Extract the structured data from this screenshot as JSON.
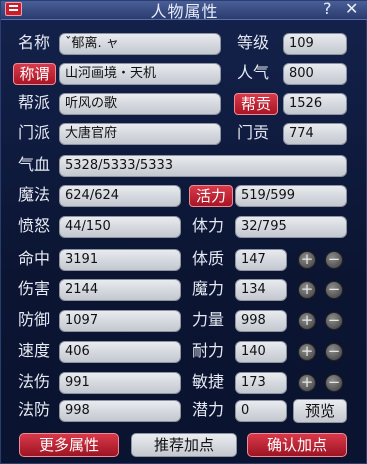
{
  "window": {
    "title": "人物属性",
    "help_icon": "?",
    "close_icon": "✕"
  },
  "profile": {
    "name_label": "名称",
    "name_value": "ˇ郁离. ャ",
    "level_label": "等级",
    "level_value": "109",
    "title_label": "称谓",
    "title_value": "山河画境・天机",
    "popularity_label": "人气",
    "popularity_value": "800",
    "gang_label": "帮派",
    "gang_value": "听风の歌",
    "contribution_label": "帮贡",
    "contribution_value": "1526",
    "school_label": "门派",
    "school_value": "大唐官府",
    "school_contrib_label": "门贡",
    "school_contrib_value": "774"
  },
  "stats": {
    "hp_label": "气血",
    "hp_value": "5328/5333/5333",
    "mp_label": "魔法",
    "mp_value": "624/624",
    "vitality_label": "活力",
    "vitality_value": "519/599",
    "rage_label": "愤怒",
    "rage_value": "44/150",
    "stamina_label": "体力",
    "stamina_value": "32/795",
    "accuracy_label": "命中",
    "accuracy_value": "3191",
    "damage_label": "伤害",
    "damage_value": "2144",
    "defense_label": "防御",
    "defense_value": "1097",
    "speed_label": "速度",
    "speed_value": "406",
    "magic_dmg_label": "法伤",
    "magic_dmg_value": "991",
    "magic_def_label": "法防",
    "magic_def_value": "998"
  },
  "attributes": {
    "constitution_label": "体质",
    "constitution_value": "147",
    "magic_label": "魔力",
    "magic_value": "134",
    "strength_label": "力量",
    "strength_value": "998",
    "endurance_label": "耐力",
    "endurance_value": "140",
    "agility_label": "敏捷",
    "agility_value": "173",
    "potential_label": "潜力",
    "potential_value": "0",
    "plus_symbol": "+",
    "minus_symbol": "−",
    "preview_label": "预览"
  },
  "footer": {
    "more_label": "更多属性",
    "recommend_label": "推荐加点",
    "confirm_label": "确认加点"
  },
  "colors": {
    "accent_red": "#c61e2e",
    "window_bg": "#0c1636",
    "field_bg": "#d9dce2"
  }
}
